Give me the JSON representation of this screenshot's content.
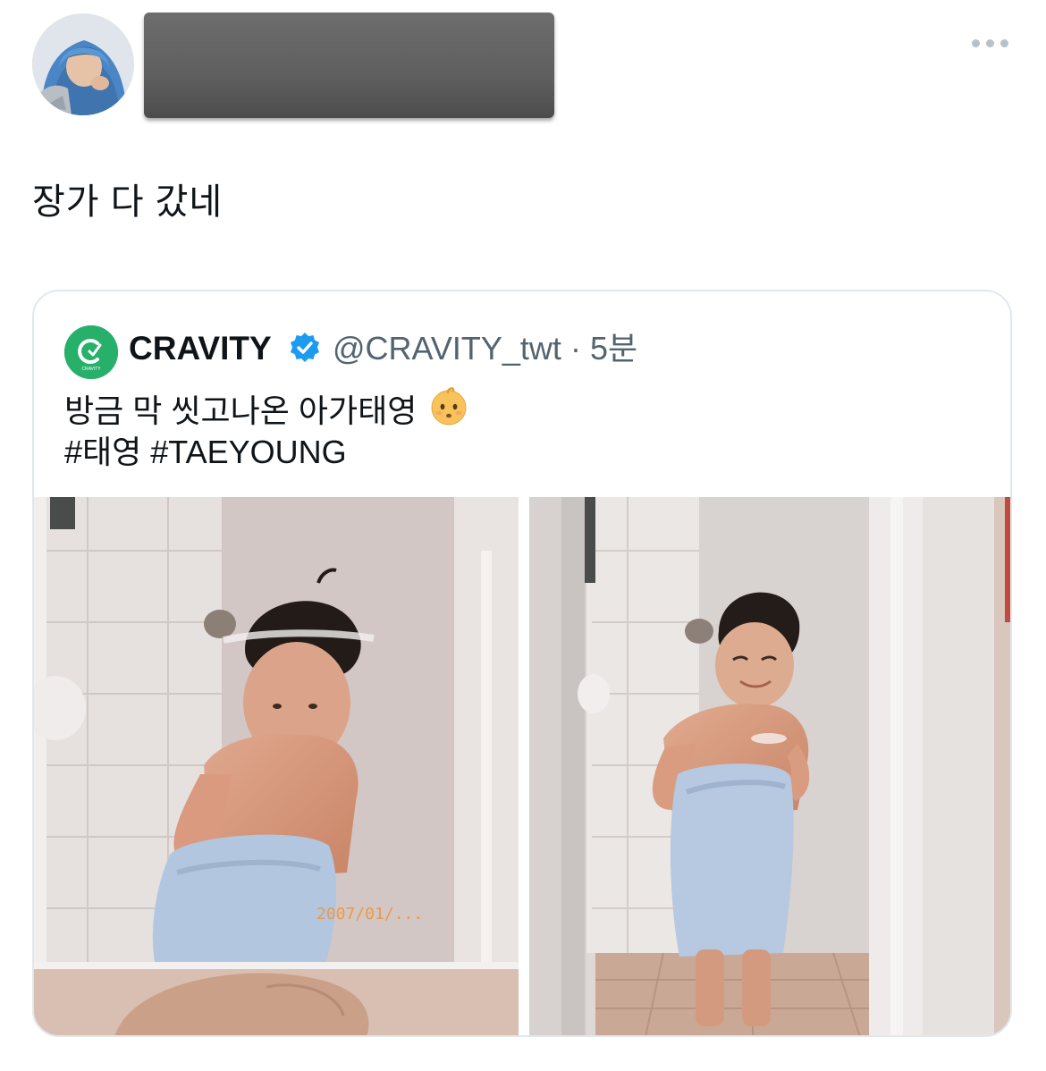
{
  "post": {
    "text": "장가 다 갔네"
  },
  "quoted_post": {
    "display_name": "CRAVITY",
    "handle": "@CRAVITY_twt",
    "separator": "·",
    "time": "5분",
    "text_line1": "방금 막 씻고나온 아가태영",
    "hashtags": "#태영 #TAEYOUNG",
    "emoji": "baby-emoji",
    "avatar_logo_text": "CRAVITY",
    "verified": true,
    "media_count": 2,
    "photo_date_stamp": "2007/01/..."
  },
  "colors": {
    "text_primary": "#0f1419",
    "text_secondary": "#536471",
    "border": "#e1e8ed",
    "verified_blue": "#1d9bf0",
    "brand_green": "#27b06a"
  },
  "icons": {
    "more": "more-horizontal-icon",
    "verified": "verified-badge-icon"
  }
}
